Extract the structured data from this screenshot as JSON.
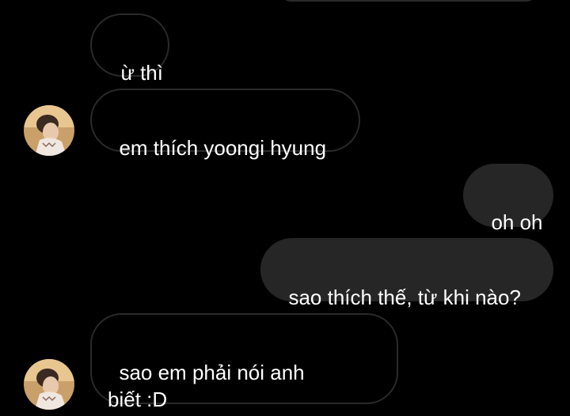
{
  "conversation": {
    "messages": [
      {
        "id": "m1",
        "direction": "incoming",
        "text": "ừ thì",
        "show_avatar": false
      },
      {
        "id": "m2",
        "direction": "incoming",
        "text": "em thích yoongi hyung",
        "show_avatar": true
      },
      {
        "id": "m3",
        "direction": "outgoing",
        "text": "oh oh"
      },
      {
        "id": "m4",
        "direction": "outgoing",
        "text": "sao thích thế, từ khi nào?"
      },
      {
        "id": "m5",
        "direction": "incoming",
        "text": "sao em phải nói anh\nbiết :D",
        "show_avatar": true
      }
    ]
  },
  "colors": {
    "background": "#000000",
    "incoming_border": "#2a2a2a",
    "outgoing_bubble": "#262626",
    "text": "#ffffff"
  }
}
